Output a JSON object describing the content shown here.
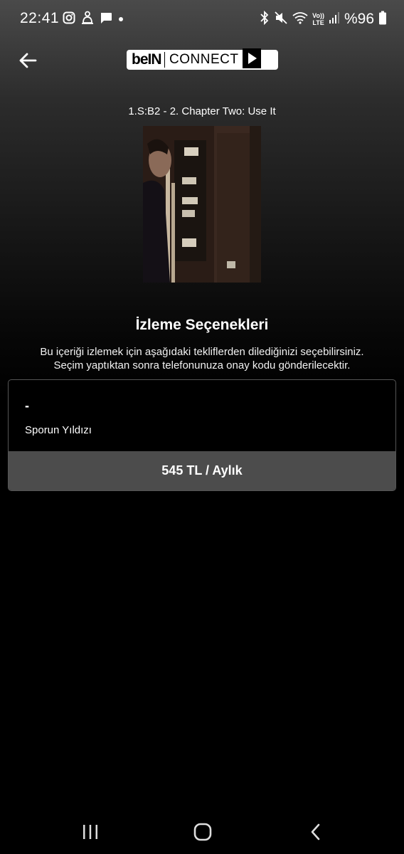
{
  "status_bar": {
    "time": "22:41",
    "battery_text": "%96",
    "left_icons": [
      "instagram-icon",
      "app-notification-icon",
      "message-icon",
      "dot-icon"
    ],
    "right_icons": [
      "bluetooth-icon",
      "mute-icon",
      "wifi-icon",
      "volte-icon",
      "signal-icon",
      "battery-icon"
    ],
    "volte_top": "Vo))",
    "volte_bottom": "LTE"
  },
  "header": {
    "back_icon": "arrow-left-icon",
    "brand_part1": "beIN",
    "brand_part2": "CONNECT",
    "brand_play_icon": "play-icon"
  },
  "content": {
    "episode_title": "1.S:B2 - 2. Chapter Two: Use It",
    "section_title": "İzleme Seçenekleri",
    "description_line1": "Bu içeriği izlemek için aşağıdaki tekliflerden dilediğinizi seçebilirsiniz.",
    "description_line2": "Seçim yaptıktan sonra telefonunuza onay kodu gönderilecektir."
  },
  "offer": {
    "dash": "-",
    "name": "Sporun Yıldızı",
    "price": "545 TL / Aylık"
  },
  "nav_bar": {
    "icons": [
      "recent-apps-icon",
      "home-icon",
      "back-icon"
    ]
  },
  "colors": {
    "background": "#000000",
    "price_bar": "#4c4c4c",
    "card_border": "#555555"
  }
}
